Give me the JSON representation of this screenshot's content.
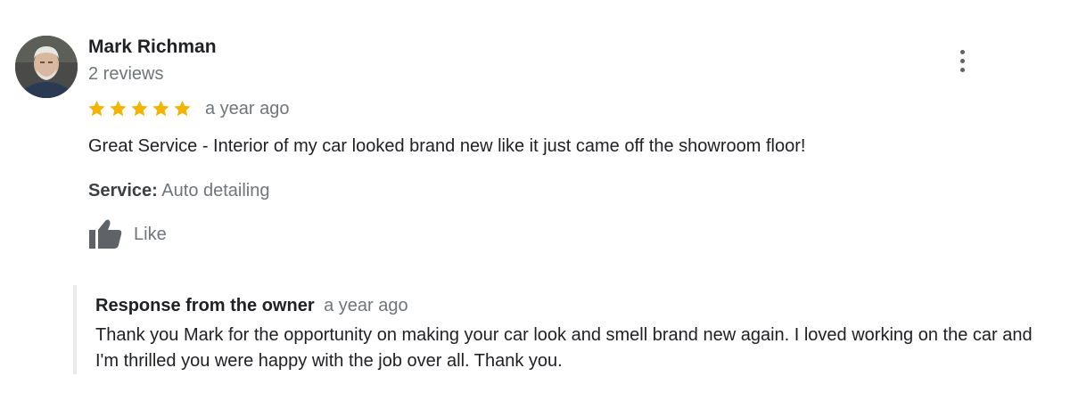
{
  "review": {
    "author": {
      "name": "Mark Richman",
      "reviews_count_text": "2 reviews",
      "avatar_icon": "avatar-photo"
    },
    "rating": 5,
    "rating_max": 5,
    "star_color": "#f4b400",
    "time": "a year ago",
    "text": "Great Service - Interior of my car looked brand new like it just came off the showroom floor!",
    "service": {
      "label": "Service:",
      "value": "Auto detailing"
    },
    "like": {
      "label": "Like",
      "icon": "thumbs-up-icon"
    },
    "more_icon": "more-vert-icon"
  },
  "owner_response": {
    "title": "Response from the owner",
    "time": "a year ago",
    "text": "Thank you Mark for the opportunity on making your car look and smell brand new again. I loved working on the car and I'm thrilled you were happy with the job over all. Thank you."
  }
}
